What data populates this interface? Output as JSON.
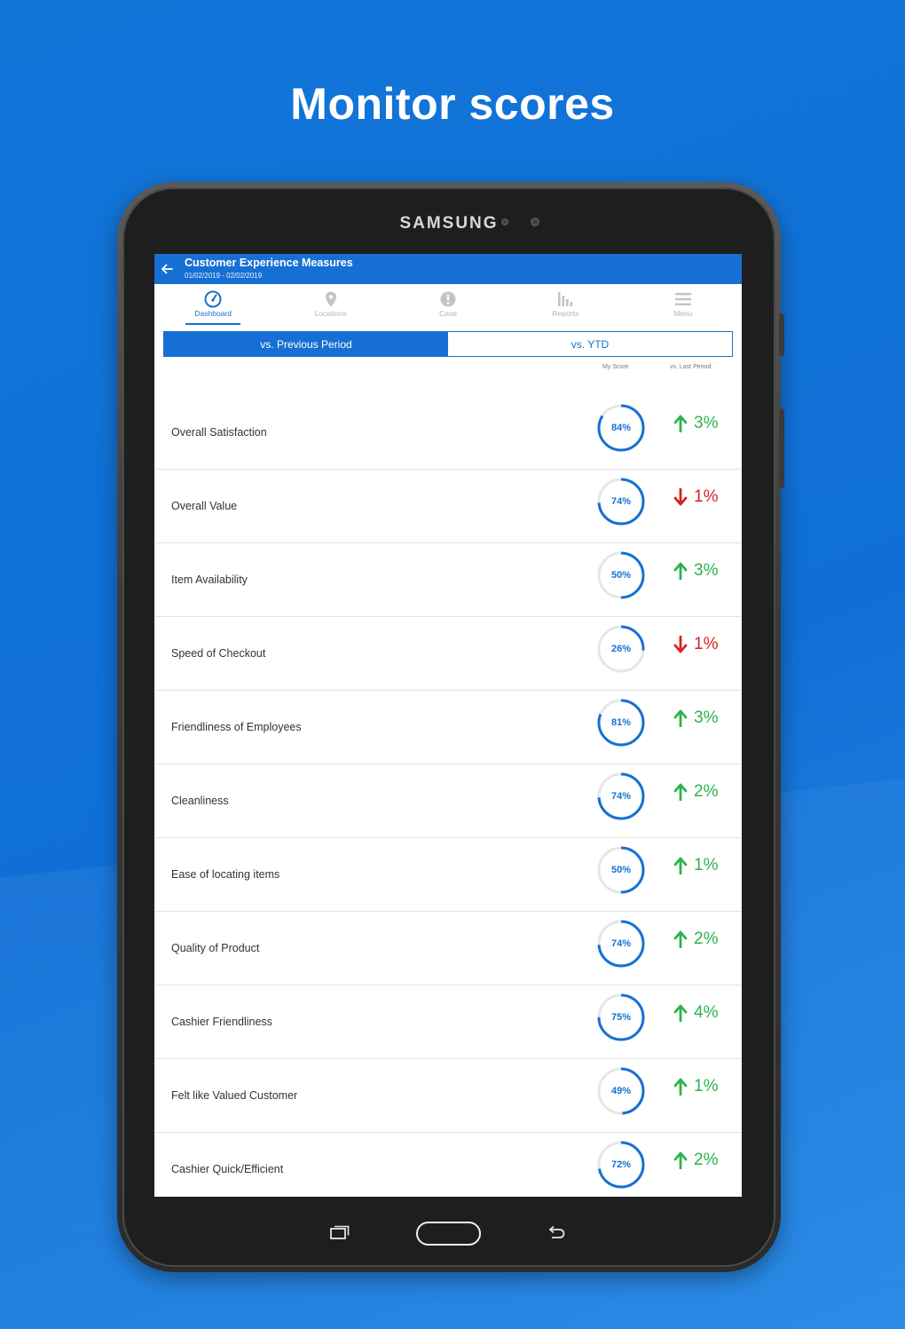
{
  "headline": "Monitor scores",
  "device_brand": "SAMSUNG",
  "app": {
    "title": "Customer Experience Measures",
    "date_range": "01/02/2019 - 02/02/2019"
  },
  "tabs": [
    {
      "label": "Dashboard",
      "icon": "dashboard-gauge-icon",
      "active": true
    },
    {
      "label": "Locations",
      "icon": "location-pin-icon",
      "active": false
    },
    {
      "label": "Case",
      "icon": "alert-icon",
      "active": false
    },
    {
      "label": "Reports",
      "icon": "bar-chart-icon",
      "active": false
    },
    {
      "label": "Menu",
      "icon": "hamburger-menu-icon",
      "active": false
    }
  ],
  "segment": {
    "selected": "vs. Previous Period",
    "other": "vs. YTD"
  },
  "columns": {
    "score": "My Score",
    "change": "vs. Last Period"
  },
  "colors": {
    "accent": "#1670d3",
    "up": "#2eb24d",
    "down": "#d92020",
    "ring_track": "#e6e6e6"
  },
  "measures": [
    {
      "name": "Overall Satisfaction",
      "score": 84,
      "score_label": "84%",
      "direction": "up",
      "change_label": "3%"
    },
    {
      "name": "Overall Value",
      "score": 74,
      "score_label": "74%",
      "direction": "down",
      "change_label": "1%"
    },
    {
      "name": "Item Availability",
      "score": 50,
      "score_label": "50%",
      "direction": "up",
      "change_label": "3%"
    },
    {
      "name": "Speed of Checkout",
      "score": 26,
      "score_label": "26%",
      "direction": "down",
      "change_label": "1%"
    },
    {
      "name": "Friendliness of Employees",
      "score": 81,
      "score_label": "81%",
      "direction": "up",
      "change_label": "3%"
    },
    {
      "name": "Cleanliness",
      "score": 74,
      "score_label": "74%",
      "direction": "up",
      "change_label": "2%"
    },
    {
      "name": "Ease of locating items",
      "score": 50,
      "score_label": "50%",
      "direction": "up",
      "change_label": "1%"
    },
    {
      "name": "Quality of Product",
      "score": 74,
      "score_label": "74%",
      "direction": "up",
      "change_label": "2%"
    },
    {
      "name": "Cashier Friendliness",
      "score": 75,
      "score_label": "75%",
      "direction": "up",
      "change_label": "4%"
    },
    {
      "name": "Felt like Valued Customer",
      "score": 49,
      "score_label": "49%",
      "direction": "up",
      "change_label": "1%"
    },
    {
      "name": "Cashier Quick/Efficient",
      "score": 72,
      "score_label": "72%",
      "direction": "up",
      "change_label": "2%"
    }
  ],
  "hardware_keys": [
    {
      "icon": "recent-apps-icon"
    },
    {
      "icon": "home-button-icon"
    },
    {
      "icon": "back-key-icon"
    }
  ]
}
